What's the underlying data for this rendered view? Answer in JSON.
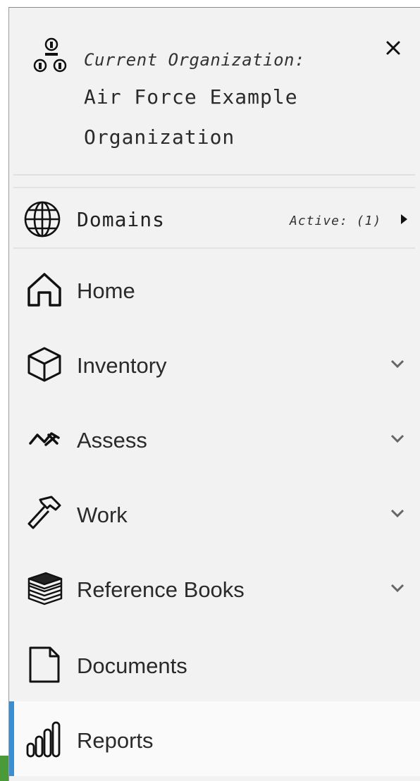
{
  "organization": {
    "label": "Current Organization:",
    "name": "Air Force Example Organization",
    "icon": "org-hierarchy-icon",
    "close_icon": "close-icon"
  },
  "domains": {
    "label": "Domains",
    "status": "Active: (1)",
    "icon": "globe-icon",
    "arrow_icon": "caret-right-icon"
  },
  "nav": {
    "items": [
      {
        "label": "Home",
        "icon": "home-icon",
        "expandable": false
      },
      {
        "label": "Inventory",
        "icon": "cube-icon",
        "expandable": true
      },
      {
        "label": "Assess",
        "icon": "assess-trend-icon",
        "expandable": true
      },
      {
        "label": "Work",
        "icon": "hammer-icon",
        "expandable": true
      },
      {
        "label": "Reference Books",
        "icon": "books-icon",
        "expandable": true
      },
      {
        "label": "Documents",
        "icon": "document-icon",
        "expandable": false
      },
      {
        "label": "Reports",
        "icon": "bar-chart-icon",
        "expandable": false,
        "active": true
      }
    ]
  },
  "colors": {
    "panel_bg": "#f2f2f2",
    "active_indicator": "#3a8fd3",
    "text": "#2a2a2a"
  }
}
